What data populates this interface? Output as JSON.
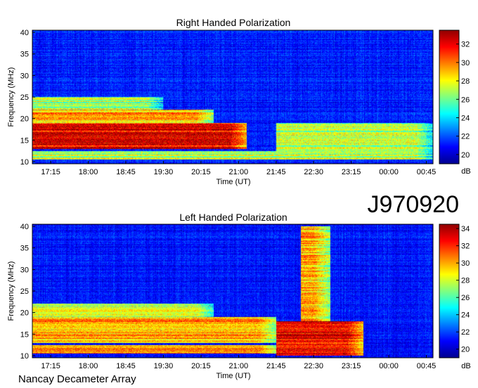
{
  "figure": {
    "observation_id": "J970920",
    "instrument": "Nancay Decameter Array"
  },
  "colors": {
    "colormap_low": "#00008f",
    "colormap_mid": "#19c8ff",
    "colormap_high": "#8f0000"
  },
  "chart_data": [
    {
      "type": "heatmap",
      "title": "Right Handed Polarization",
      "xlabel": "Time (UT)",
      "ylabel": "Frequency (MHz)",
      "x_tick_labels": [
        "17:15",
        "18:00",
        "18:45",
        "19:30",
        "20:15",
        "21:00",
        "21:45",
        "22:30",
        "23:15",
        "00:00",
        "00:45"
      ],
      "x_start": "16:53",
      "x_end": "00:53",
      "ylim": [
        9.5,
        40.5
      ],
      "y_ticks": [
        10,
        15,
        20,
        25,
        30,
        35,
        40
      ],
      "colorbar": {
        "label": "dB",
        "range": [
          19,
          33.5
        ],
        "ticks": [
          20,
          22,
          24,
          26,
          28,
          30,
          32
        ]
      },
      "emission_bands": [
        {
          "freq_range": [
            10.5,
            12.5
          ],
          "time_range": [
            "16:53",
            "00:53"
          ],
          "level_db": 27
        },
        {
          "freq_range": [
            13,
            19
          ],
          "time_range": [
            "16:53",
            "21:10"
          ],
          "level_db": 32
        },
        {
          "freq_range": [
            19,
            22
          ],
          "time_range": [
            "16:53",
            "20:30"
          ],
          "level_db": 29
        },
        {
          "freq_range": [
            22,
            25
          ],
          "time_range": [
            "16:53",
            "19:30"
          ],
          "level_db": 27
        },
        {
          "freq_range": [
            12,
            19
          ],
          "time_range": [
            "21:45",
            "00:53"
          ],
          "level_db": 27
        }
      ]
    },
    {
      "type": "heatmap",
      "title": "Left Handed Polarization",
      "xlabel": "Time (UT)",
      "ylabel": "Frequency (MHz)",
      "x_tick_labels": [
        "17:15",
        "18:00",
        "18:45",
        "19:30",
        "20:15",
        "21:00",
        "21:45",
        "22:30",
        "23:15",
        "00:00",
        "00:45"
      ],
      "x_start": "16:53",
      "x_end": "00:53",
      "ylim": [
        9.5,
        40.5
      ],
      "y_ticks": [
        10,
        15,
        20,
        25,
        30,
        35,
        40
      ],
      "colorbar": {
        "label": "dB",
        "range": [
          19,
          34.5
        ],
        "ticks": [
          20,
          22,
          24,
          26,
          28,
          30,
          32,
          34
        ]
      },
      "emission_bands": [
        {
          "freq_range": [
            10.5,
            12.5
          ],
          "time_range": [
            "16:53",
            "21:45"
          ],
          "level_db": 31
        },
        {
          "freq_range": [
            13,
            19
          ],
          "time_range": [
            "16:53",
            "21:45"
          ],
          "level_db": 30
        },
        {
          "freq_range": [
            19,
            22
          ],
          "time_range": [
            "16:53",
            "20:30"
          ],
          "level_db": 28
        },
        {
          "freq_range": [
            10,
            18
          ],
          "time_range": [
            "21:45",
            "23:30"
          ],
          "level_db": 33
        },
        {
          "freq_range": [
            18,
            40
          ],
          "time_range": [
            "22:15",
            "22:50"
          ],
          "level_db": 30
        }
      ]
    }
  ]
}
